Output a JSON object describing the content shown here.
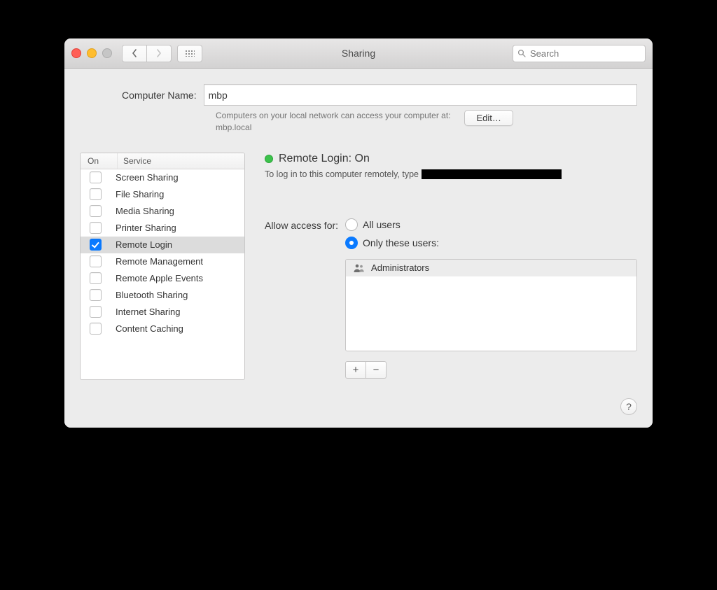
{
  "window": {
    "title": "Sharing"
  },
  "search": {
    "placeholder": "Search"
  },
  "computer_name": {
    "label": "Computer Name:",
    "value": "mbp",
    "hint_line1": "Computers on your local network can access your computer at:",
    "hint_line2": "mbp.local",
    "edit_button": "Edit…"
  },
  "services": {
    "col_on": "On",
    "col_service": "Service",
    "items": [
      {
        "label": "Screen Sharing",
        "on": false,
        "selected": false
      },
      {
        "label": "File Sharing",
        "on": false,
        "selected": false
      },
      {
        "label": "Media Sharing",
        "on": false,
        "selected": false
      },
      {
        "label": "Printer Sharing",
        "on": false,
        "selected": false
      },
      {
        "label": "Remote Login",
        "on": true,
        "selected": true
      },
      {
        "label": "Remote Management",
        "on": false,
        "selected": false
      },
      {
        "label": "Remote Apple Events",
        "on": false,
        "selected": false
      },
      {
        "label": "Bluetooth Sharing",
        "on": false,
        "selected": false
      },
      {
        "label": "Internet Sharing",
        "on": false,
        "selected": false
      },
      {
        "label": "Content Caching",
        "on": false,
        "selected": false
      }
    ]
  },
  "detail": {
    "status": "Remote Login: On",
    "login_hint": "To log in to this computer remotely, type",
    "allow_label": "Allow access for:",
    "radio_all": "All users",
    "radio_only": "Only these users:",
    "users": [
      {
        "label": "Administrators"
      }
    ],
    "add": "+",
    "remove": "−"
  },
  "help": "?"
}
